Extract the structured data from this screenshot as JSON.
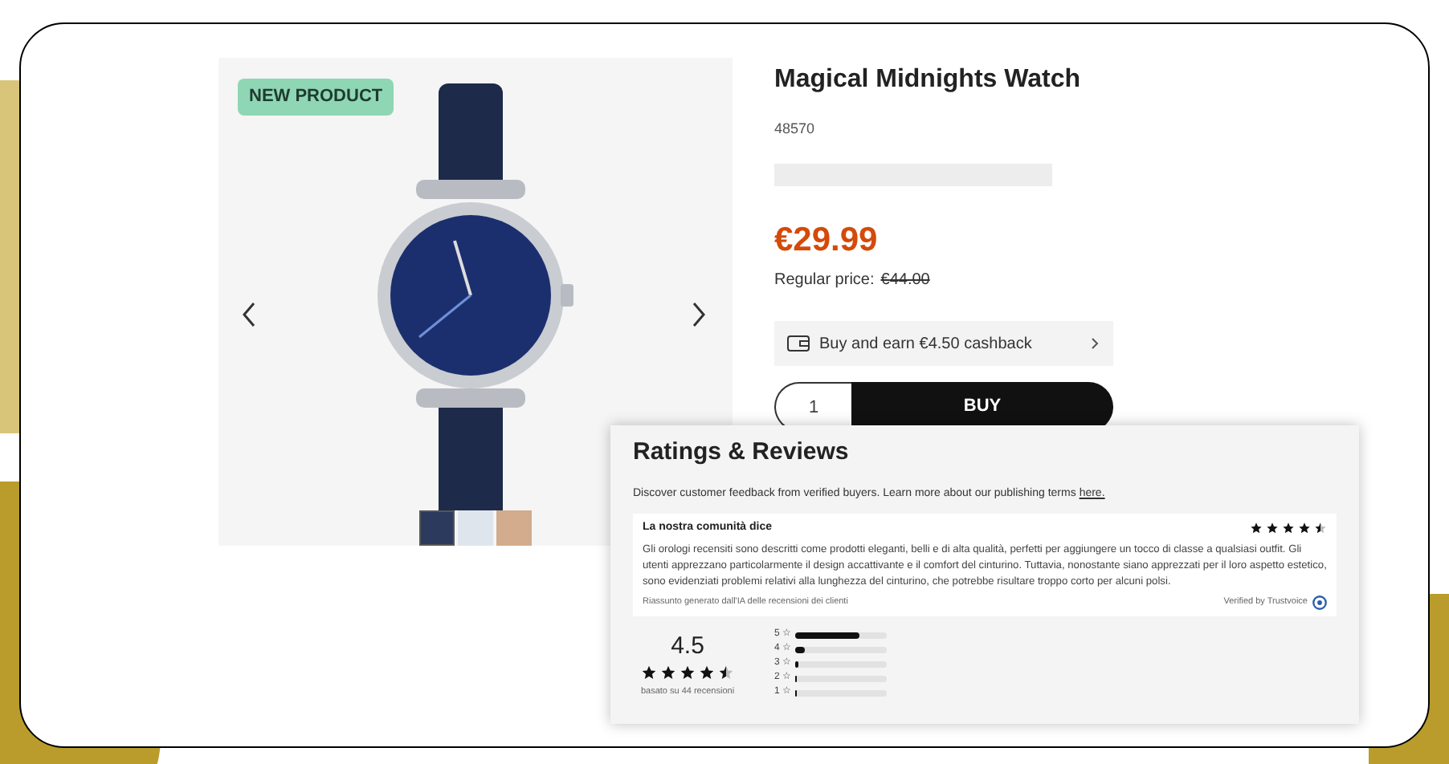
{
  "product": {
    "badge": "NEW PRODUCT",
    "title": "Magical Midnights Watch",
    "code": "48570",
    "price": "€29.99",
    "regular_price_label": "Regular price:",
    "regular_price": "€44.00",
    "cashback": "Buy and earn €4.50 cashback",
    "quantity": "1",
    "buy_button": "BUY",
    "thumbnails": [
      {
        "selected": true
      },
      {
        "selected": false
      },
      {
        "selected": false
      }
    ]
  },
  "reviews": {
    "title": "Ratings & Reviews",
    "intro": "Discover customer feedback from verified buyers. Learn more about our publishing terms",
    "intro_link": "here.",
    "summary": {
      "heading": "La nostra comunità dice",
      "stars": 4.5,
      "text": "Gli orologi recensiti sono descritti come prodotti eleganti, belli e di alta qualità, perfetti per aggiungere un tocco di classe a qualsiasi outfit. Gli utenti apprezzano particolarmente il design accattivante e il comfort del cinturino. Tuttavia, nonostante siano apprezzati per il loro aspetto estetico, sono evidenziati problemi relativi alla lunghezza del cinturino, che potrebbe risultare troppo corto per alcuni polsi.",
      "footer": "Riassunto generato dall'IA delle recensioni dei clienti",
      "verified": "Verified by Trustvoice"
    },
    "average": "4.5",
    "stars": 4.5,
    "count": "basato su 44 recensioni",
    "distribution": [
      {
        "label": "5 ☆",
        "level": 0.7
      },
      {
        "label": "4 ☆",
        "level": 0.1
      },
      {
        "label": "3 ☆",
        "level": 0.04
      },
      {
        "label": "2 ☆",
        "level": 0.01
      },
      {
        "label": "1 ☆",
        "level": 0.01
      }
    ]
  }
}
